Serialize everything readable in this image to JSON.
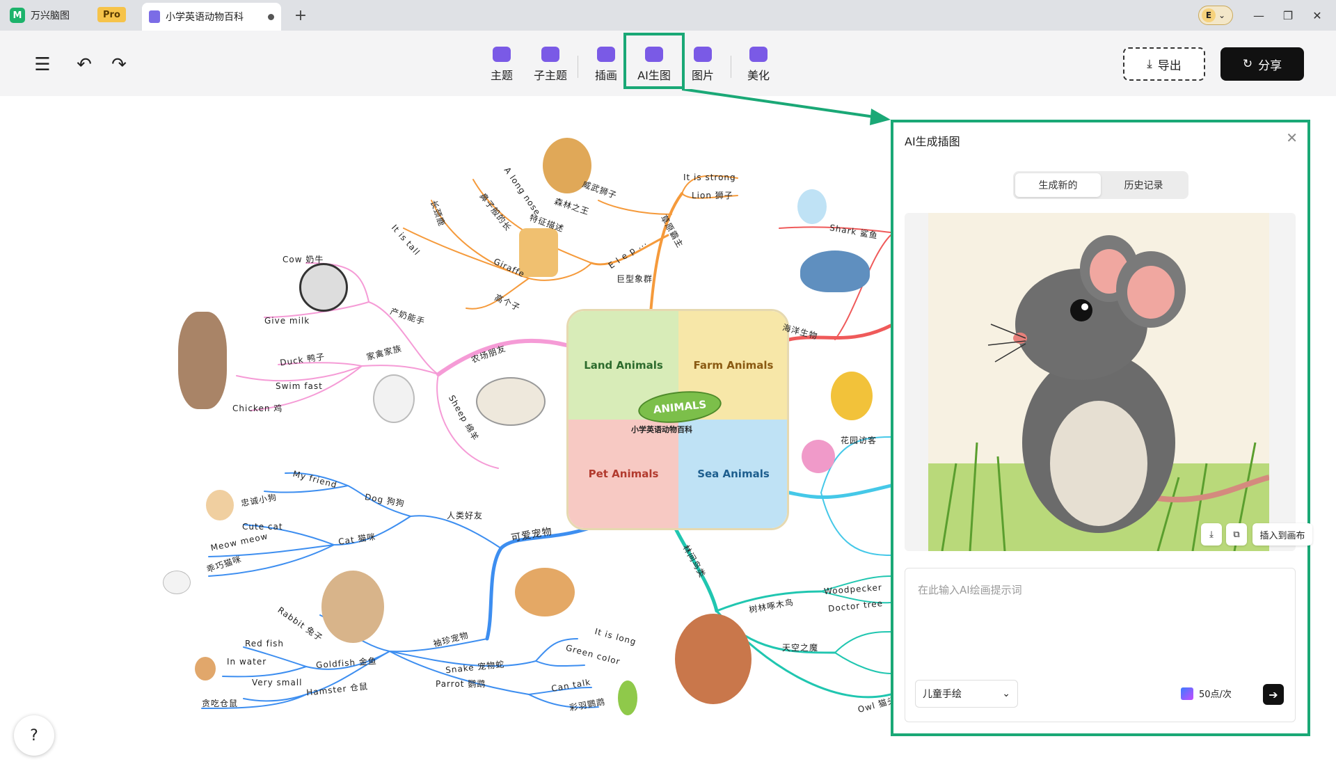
{
  "tabs": {
    "app_name": "万兴脑图",
    "pro_label": "Pro",
    "doc_title": "小学英语动物百科",
    "new_tab_glyph": "+"
  },
  "window": {
    "avatar_initial": "E",
    "minimize": "—",
    "restore": "❐",
    "close": "✕"
  },
  "toolbar": {
    "menu_glyph": "☰",
    "undo_glyph": "↶",
    "redo_glyph": "↷",
    "tools": [
      {
        "label": "主题"
      },
      {
        "label": "子主题"
      },
      {
        "label": "插画"
      },
      {
        "label": "AI生图"
      },
      {
        "label": "图片"
      },
      {
        "label": "美化"
      }
    ],
    "export_label": "导出",
    "share_label": "分享"
  },
  "mindmap": {
    "center": {
      "title": "ANIMALS",
      "subtitle": "小学英语动物百科",
      "quadrants": [
        "Land Animals",
        "Farm Animals",
        "Pet Animals",
        "Sea Animals"
      ]
    },
    "labels": [
      "It is strong",
      "Lion 狮子",
      "威武狮子",
      "森林之王",
      "草原霸主",
      "A long nose",
      "鼻子般的长",
      "特征描述",
      "E l e p ...",
      "巨型象群",
      "长颈鹿",
      "It is tall",
      "Giraffe",
      "高个子",
      "Cow 奶牛",
      "产奶能手",
      "Give milk",
      "Duck 鸭子",
      "家禽家族",
      "Swim fast",
      "Chicken 鸡",
      "农场朋友",
      "Sheep 绵羊",
      "My friend",
      "Dog 狗狗",
      "忠诚小狗",
      "人类好友",
      "Cute cat",
      "Cat 猫咪",
      "Meow meow",
      "乖巧猫咪",
      "可爱宠物",
      "Rabbit 兔子",
      "Red fish",
      "In water",
      "Goldfish 金鱼",
      "Very small",
      "Hamster 仓鼠",
      "贪吃仓鼠",
      "袖珍宠物",
      "It is long",
      "Green color",
      "Snake 宠物蛇",
      "Parrot 鹦鹉",
      "Can talk",
      "彩羽鹦鹉",
      "Shark 鲨鱼",
      "海洋生物",
      "花园访客",
      "林间鸟类",
      "树林啄木鸟",
      "Woodpecker",
      "Doctor tree",
      "天空之魔",
      "Owl 猫头"
    ]
  },
  "help_glyph": "?",
  "ai_panel": {
    "title": "AI生成插图",
    "close_glyph": "✕",
    "tabs": [
      "生成新的",
      "历史记录"
    ],
    "active_tab": 0,
    "image_subject": "mouse illustration",
    "insert_label": "插入到画布",
    "prompt_placeholder": "在此输入AI绘画提示词",
    "style_value": "儿童手绘",
    "cost_label": "50点/次",
    "send_glyph": "➔"
  },
  "colors": {
    "highlight": "#1aa876",
    "orange_branch": "#f59a3b",
    "pink_branch": "#f59bd6",
    "blue_branch": "#3d8ef0",
    "red_branch": "#ef5a5a",
    "cyan_branch": "#45c8e8",
    "teal_branch": "#20c6b0"
  }
}
